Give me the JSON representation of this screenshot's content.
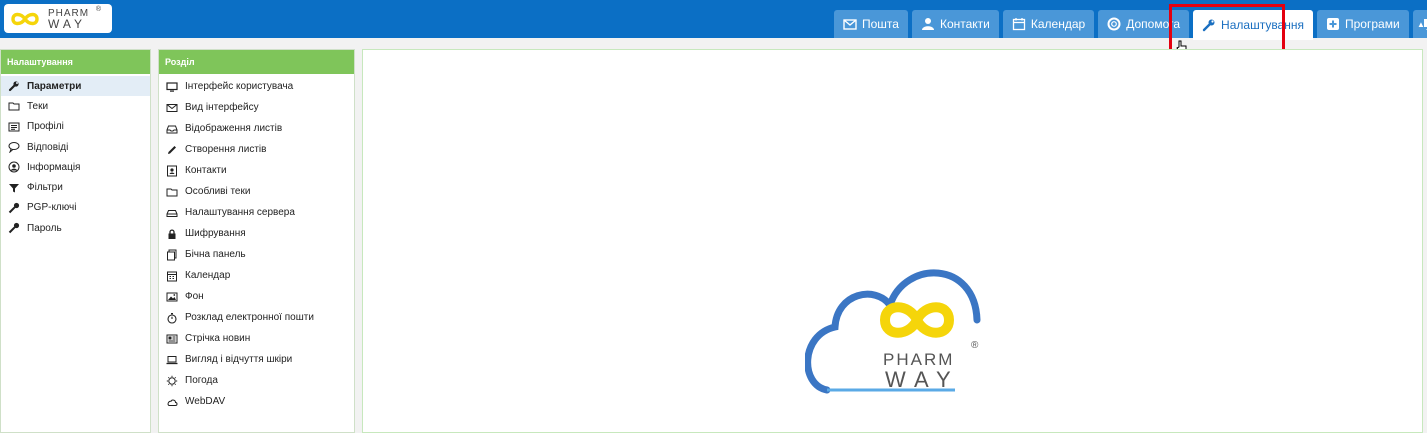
{
  "brand": {
    "logo_line1": "PHARM",
    "logo_line2": "WAY",
    "registered": "®",
    "accent_yellow": "#f5d50a",
    "accent_blue": "#0b6fc5"
  },
  "topnav": {
    "tabs": [
      {
        "label": "Пошта",
        "icon": "mail-icon"
      },
      {
        "label": "Контакти",
        "icon": "user-icon"
      },
      {
        "label": "Календар",
        "icon": "calendar-icon"
      },
      {
        "label": "Допомога",
        "icon": "lifebuoy-icon"
      },
      {
        "label": "Налаштування",
        "icon": "wrench-icon",
        "active": true
      },
      {
        "label": "Програми",
        "icon": "plus-square-icon"
      },
      {
        "label": "",
        "icon": "monitor-icon"
      }
    ]
  },
  "left_panel": {
    "title": "Налаштування",
    "items": [
      {
        "label": "Параметри",
        "icon": "wrench-icon",
        "selected": true
      },
      {
        "label": "Теки",
        "icon": "folder-icon"
      },
      {
        "label": "Профілі",
        "icon": "id-card-icon"
      },
      {
        "label": "Відповіді",
        "icon": "speech-bubble-icon"
      },
      {
        "label": "Інформація",
        "icon": "user-circle-icon"
      },
      {
        "label": "Фільтри",
        "icon": "filter-icon"
      },
      {
        "label": "PGP-ключі",
        "icon": "key-icon"
      },
      {
        "label": "Пароль",
        "icon": "key-icon"
      }
    ]
  },
  "section_panel": {
    "title": "Розділ",
    "items": [
      {
        "label": "Інтерфейс користувача",
        "icon": "monitor-icon"
      },
      {
        "label": "Вид інтерфейсу",
        "icon": "envelope-icon"
      },
      {
        "label": "Відображення листів",
        "icon": "inbox-icon"
      },
      {
        "label": "Створення листів",
        "icon": "pencil-icon"
      },
      {
        "label": "Контакти",
        "icon": "contact-card-icon"
      },
      {
        "label": "Особливі теки",
        "icon": "folder-icon"
      },
      {
        "label": "Налаштування сервера",
        "icon": "server-icon"
      },
      {
        "label": "Шифрування",
        "icon": "lock-icon"
      },
      {
        "label": "Бічна панель",
        "icon": "copy-icon"
      },
      {
        "label": "Календар",
        "icon": "calendar-icon"
      },
      {
        "label": "Фон",
        "icon": "image-icon"
      },
      {
        "label": "Розклад електронної пошти",
        "icon": "stopwatch-icon"
      },
      {
        "label": "Стрічка новин",
        "icon": "newspaper-icon"
      },
      {
        "label": "Вигляд і відчуття шкіри",
        "icon": "laptop-icon"
      },
      {
        "label": "Погода",
        "icon": "sun-icon"
      },
      {
        "label": "WebDAV",
        "icon": "cloud-icon"
      }
    ]
  },
  "content": {
    "logo_line1": "PHARM",
    "logo_line2": "WAY",
    "registered": "®"
  }
}
